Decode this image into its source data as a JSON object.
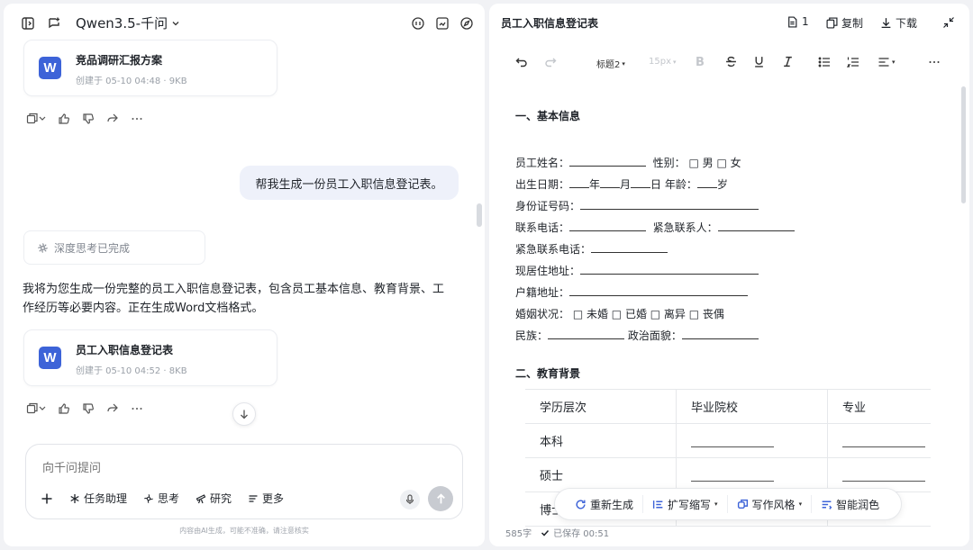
{
  "left": {
    "model_name": "Qwen3.5-千问",
    "cards": [
      {
        "title": "竞品调研汇报方案",
        "meta": "创建于 05-10 04:48 · 9KB",
        "icon": "W"
      },
      {
        "title": "员工入职信息登记表",
        "meta": "创建于 05-10 04:52 · 8KB",
        "icon": "W"
      }
    ],
    "user_message": "帮我生成一份员工入职信息登记表。",
    "thinking_status": "深度思考已完成",
    "reply": "我将为您生成一份完整的员工入职信息登记表，包含员工基本信息、教育背景、工作经历等必要内容。正在生成Word文档格式。",
    "input_placeholder": "向千问提问",
    "tools": [
      "任务助理",
      "思考",
      "研究",
      "更多"
    ],
    "disclaimer": "内容由AI生成，可能不准确，请注意核实"
  },
  "right": {
    "doc_title": "员工入职信息登记表",
    "page_count": "1",
    "copy_label": "复制",
    "download_label": "下载",
    "heading_style": "标题2",
    "font_size": "15px",
    "section1": "一、基本信息",
    "fields": [
      {
        "a": "员工姓名：",
        "b": "性别：",
        "c": "□ 男 □ 女"
      },
      {
        "a": "出生日期：",
        "b": "年",
        "c": "月",
        "d": "日 年龄：",
        "e": "岁"
      },
      {
        "a": "身份证号码："
      },
      {
        "a": "联系电话：",
        "b": "紧急联系人："
      },
      {
        "a": "紧急联系电话："
      },
      {
        "a": "现居住地址："
      },
      {
        "a": "户籍地址："
      },
      {
        "a": "婚姻状况：",
        "b": "□ 未婚 □ 已婚 □ 离异 □ 丧偶"
      },
      {
        "a": "民族：",
        "b": "政治面貌："
      }
    ],
    "section2": "二、教育背景",
    "table_headers": [
      "学历层次",
      "毕业院校",
      "专业"
    ],
    "table_rows": [
      "本科",
      "硕士",
      "博士"
    ],
    "float_actions": [
      "重新生成",
      "扩写缩写",
      "写作风格",
      "智能润色"
    ],
    "word_count": "585字",
    "save_status": "已保存 00:51"
  }
}
